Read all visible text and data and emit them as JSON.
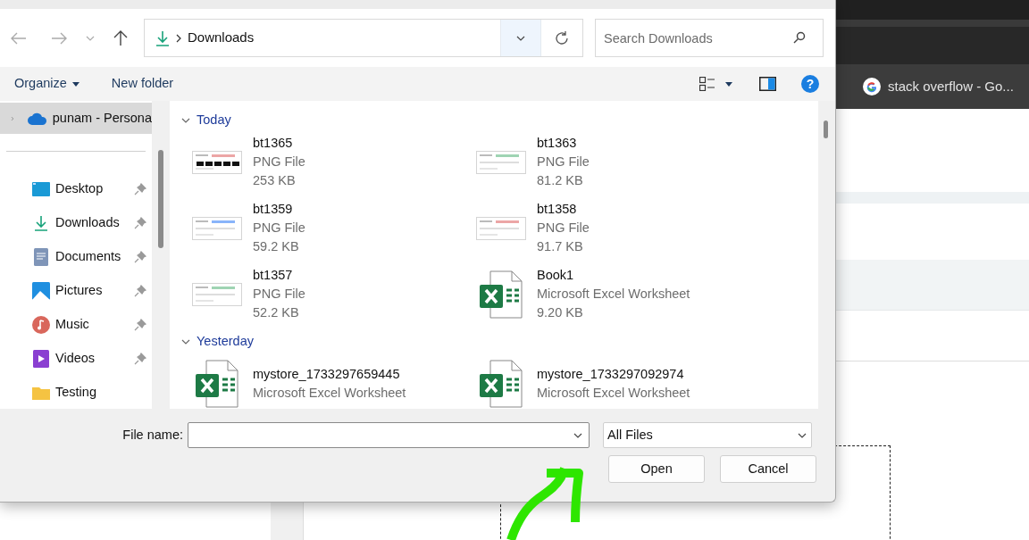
{
  "browser": {
    "bookmark": "stack overflow - Go..."
  },
  "address_bar": {
    "location": "Downloads"
  },
  "search": {
    "placeholder": "Search Downloads"
  },
  "toolbar": {
    "organize": "Organize",
    "new_folder": "New folder",
    "help": "?"
  },
  "sidebar": {
    "items": [
      {
        "label": "punam - Persona",
        "kind": "cloud",
        "selected": true
      },
      {
        "label": "Desktop",
        "kind": "desktop",
        "selected": false,
        "pinned": true
      },
      {
        "label": "Downloads",
        "kind": "download",
        "selected": false,
        "pinned": true
      },
      {
        "label": "Documents",
        "kind": "documents",
        "selected": false,
        "pinned": true
      },
      {
        "label": "Pictures",
        "kind": "pictures",
        "selected": false,
        "pinned": true
      },
      {
        "label": "Music",
        "kind": "music",
        "selected": false,
        "pinned": true
      },
      {
        "label": "Videos",
        "kind": "videos",
        "selected": false,
        "pinned": true
      },
      {
        "label": "Testing",
        "kind": "folder",
        "selected": false,
        "pinned": false
      }
    ]
  },
  "groups": [
    {
      "label": "Today",
      "expanded": true,
      "files": [
        {
          "name": "bt1365",
          "type": "PNG File",
          "size": "253 KB",
          "kind": "png"
        },
        {
          "name": "bt1363",
          "type": "PNG File",
          "size": "81.2 KB",
          "kind": "png"
        },
        {
          "name": "bt1359",
          "type": "PNG File",
          "size": "59.2 KB",
          "kind": "png"
        },
        {
          "name": "bt1358",
          "type": "PNG File",
          "size": "91.7 KB",
          "kind": "png"
        },
        {
          "name": "bt1357",
          "type": "PNG File",
          "size": "52.2 KB",
          "kind": "png"
        },
        {
          "name": "Book1",
          "type": "Microsoft Excel Worksheet",
          "size": "9.20 KB",
          "kind": "excel"
        }
      ]
    },
    {
      "label": "Yesterday",
      "expanded": true,
      "files": [
        {
          "name": "mystore_1733297659445",
          "type": "Microsoft Excel Worksheet",
          "kind": "excel"
        },
        {
          "name": "mystore_1733297092974",
          "type": "Microsoft Excel Worksheet",
          "kind": "excel"
        }
      ]
    }
  ],
  "file_name": {
    "label": "File name:"
  },
  "file_type": {
    "value": "All Files"
  },
  "buttons": [
    "Open",
    "Cancel"
  ]
}
